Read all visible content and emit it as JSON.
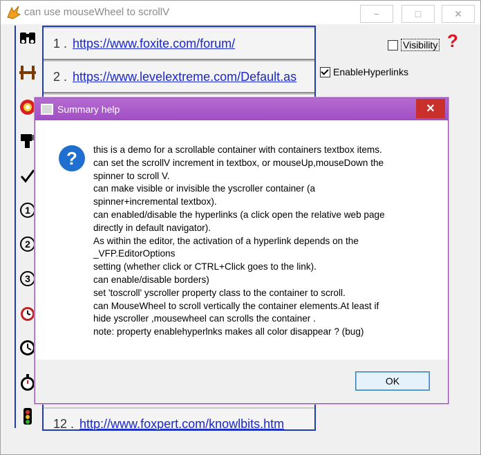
{
  "window": {
    "title": "can use mouseWheel to scrollV",
    "controls": {
      "minimize": "−",
      "maximize": "□",
      "close": "✕"
    }
  },
  "icons": [
    "binoculars-icon",
    "barbell-icon",
    "lifebuoy-icon",
    "flashlight-icon",
    "checkmark-icon",
    "number-1-icon",
    "number-2-icon",
    "number-3-icon",
    "alarm-clock-icon",
    "clock-icon",
    "stopwatch-icon",
    "traffic-light-icon"
  ],
  "list": {
    "items": [
      {
        "num": "1 .",
        "link": "https://www.foxite.com/forum/"
      },
      {
        "num": "2 .",
        "link": "https://www.levelextreme.com/Default.as"
      },
      {
        "num": "12 .",
        "link": "http://www.foxpert.com/knowlbits.htm"
      }
    ]
  },
  "options": {
    "visibility_label": "Visibility",
    "visibility_checked": false,
    "enable_hyperlinks_label": "EnableHyperlinks",
    "enable_hyperlinks_checked": true,
    "help_mark": "?"
  },
  "dialog": {
    "title": "Summary help",
    "close_label": "✕",
    "icon_glyph": "?",
    "lines": [
      "this is a demo for a scrollable container with containers textbox items.",
      "can set the scrollV increment in textbox, or mouseUp,mouseDown the",
      "spinner to scroll V.",
      "can make visible or invisible the yscroller container (a",
      "spinner+incremental textbox).",
      "can enabled/disable the hyperlinks (a click open the relative web page",
      "directly in default navigator).",
      "As within the editor, the activation of a hyperlink depends on the",
      "_VFP.EditorOptions",
      "setting (whether click or CTRL+Click goes to the link).",
      "can enable/disable borders)",
      "set 'toscroll' yscroller property class to the container to scroll.",
      "can MouseWheel to scroll vertically the container elements.At least if",
      "hide yscroller ,mousewheel can scrolls the container .",
      "note:  property enablehyperlnks makes all color disappear ? (bug)"
    ],
    "ok_label": "OK"
  },
  "colors": {
    "accent_border": "#1e3bb0",
    "link": "#1a27cc",
    "dialog_titlebar": "#a04fc4",
    "close_red": "#c9302c",
    "help_blue": "#1f6fd0",
    "question_red": "#e0101a"
  }
}
